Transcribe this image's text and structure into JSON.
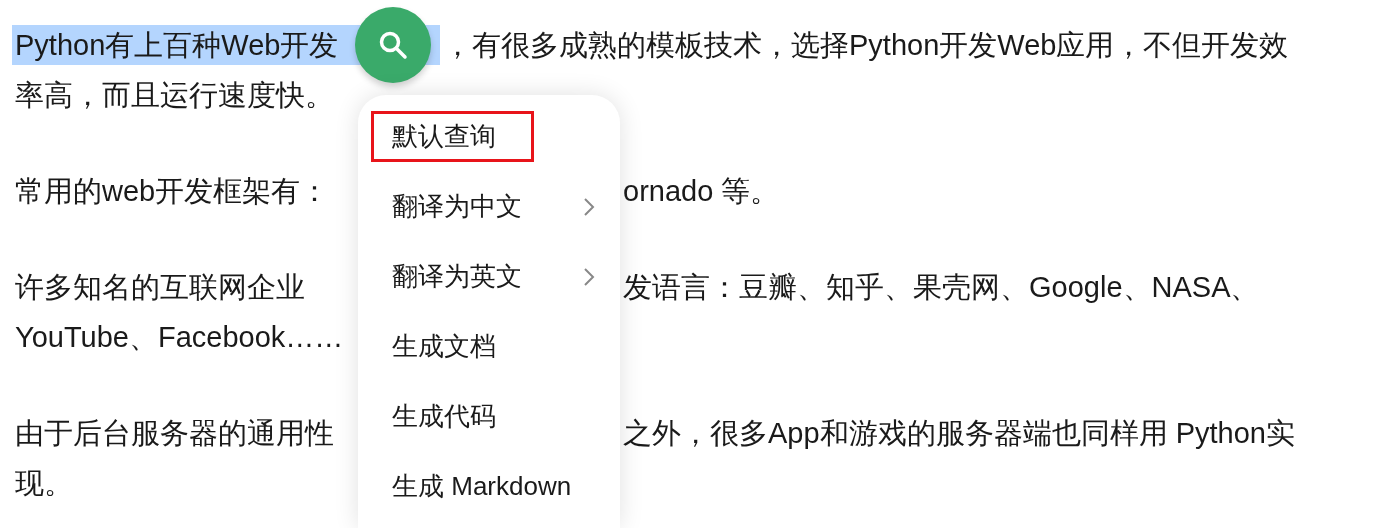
{
  "document": {
    "paragraphs": [
      {
        "lines": [
          {
            "segments": [
              {
                "text": "Python有上百种Web开发",
                "selected": true
              },
              {
                "text": "，有很多成熟的模板技术，选择Python开发Web应用，不但开发效",
                "selected": false
              }
            ]
          },
          {
            "segments": [
              {
                "text": "率高，而且运行速度快。",
                "selected": false
              }
            ]
          }
        ]
      },
      {
        "lines": [
          {
            "segments": [
              {
                "text": "常用的web开发框架有：",
                "selected": false
              },
              {
                "text": "ornado 等。",
                "selected": false
              }
            ]
          }
        ]
      },
      {
        "lines": [
          {
            "segments": [
              {
                "text": "许多知名的互联网企业",
                "selected": false
              },
              {
                "text": "发语言：豆瓣、知乎、果壳网、Google、NASA、",
                "selected": false
              }
            ]
          },
          {
            "segments": [
              {
                "text": "YouTube、Facebook……",
                "selected": false
              }
            ]
          }
        ]
      },
      {
        "lines": [
          {
            "segments": [
              {
                "text": "由于后台服务器的通用性",
                "selected": false
              },
              {
                "text": "之外，很多App和游戏的服务器端也同样用 Python实",
                "selected": false
              }
            ]
          },
          {
            "segments": [
              {
                "text": "现。",
                "selected": false
              }
            ]
          }
        ]
      }
    ]
  },
  "context_menu": {
    "items": [
      {
        "label": "默认查询",
        "selected": true,
        "has_submenu": false
      },
      {
        "label": "翻译为中文",
        "selected": false,
        "has_submenu": true
      },
      {
        "label": "翻译为英文",
        "selected": false,
        "has_submenu": true
      },
      {
        "label": "生成文档",
        "selected": false,
        "has_submenu": false
      },
      {
        "label": "生成代码",
        "selected": false,
        "has_submenu": false
      },
      {
        "label": "生成 Markdown",
        "selected": false,
        "has_submenu": false
      }
    ]
  }
}
